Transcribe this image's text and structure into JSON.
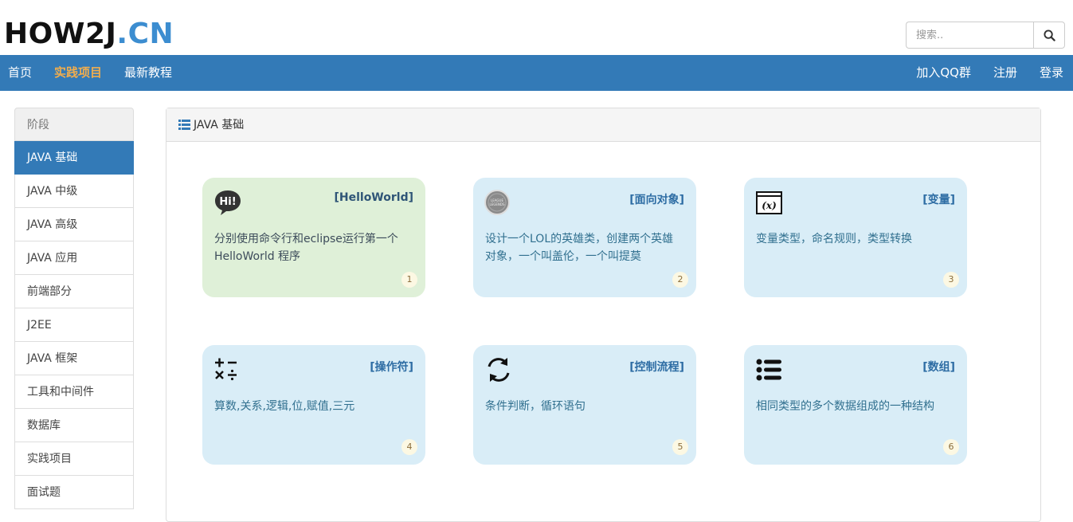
{
  "logo": {
    "part1": "HOW2J",
    "part2": ".CN"
  },
  "search": {
    "placeholder": "搜索.."
  },
  "nav": {
    "left": [
      "首页",
      "实践项目",
      "最新教程"
    ],
    "right": [
      "加入QQ群",
      "注册",
      "登录"
    ]
  },
  "sidebar": {
    "header": "阶段",
    "items": [
      "JAVA 基础",
      "JAVA 中级",
      "JAVA 高级",
      "JAVA 应用",
      "前端部分",
      "J2EE",
      "JAVA 框架",
      "工具和中间件",
      "数据库",
      "实践项目",
      "面试题"
    ]
  },
  "panel": {
    "title": "JAVA 基础"
  },
  "cards": [
    {
      "title": "[HelloWorld]",
      "desc": "分别使用命令行和eclipse运行第一个HelloWorld 程序",
      "badge": "1",
      "icon": "hi-speech-bubble-icon"
    },
    {
      "title": "[面向对象]",
      "desc": "设计一个LOL的英雄类，创建两个英雄对象，一个叫盖伦，一个叫提莫",
      "badge": "2",
      "icon": "league-of-legends-logo-icon"
    },
    {
      "title": "[变量]",
      "desc": "变量类型，命名规则，类型转换",
      "badge": "3",
      "icon": "variable-x-window-icon"
    },
    {
      "title": "[操作符]",
      "desc": "算数,关系,逻辑,位,赋值,三元",
      "badge": "4",
      "icon": "math-operators-icon"
    },
    {
      "title": "[控制流程]",
      "desc": "条件判断，循环语句",
      "badge": "5",
      "icon": "loop-arrows-icon"
    },
    {
      "title": "[数组]",
      "desc": "相同类型的多个数据组成的一种结构",
      "badge": "6",
      "icon": "list-icon"
    }
  ],
  "colors": {
    "primary": "#337ab7",
    "active_nav": "#f0ad4e",
    "card_blue": "#d9edf7",
    "card_green": "#dff0d8",
    "logo_blue": "#3c8dd0"
  }
}
